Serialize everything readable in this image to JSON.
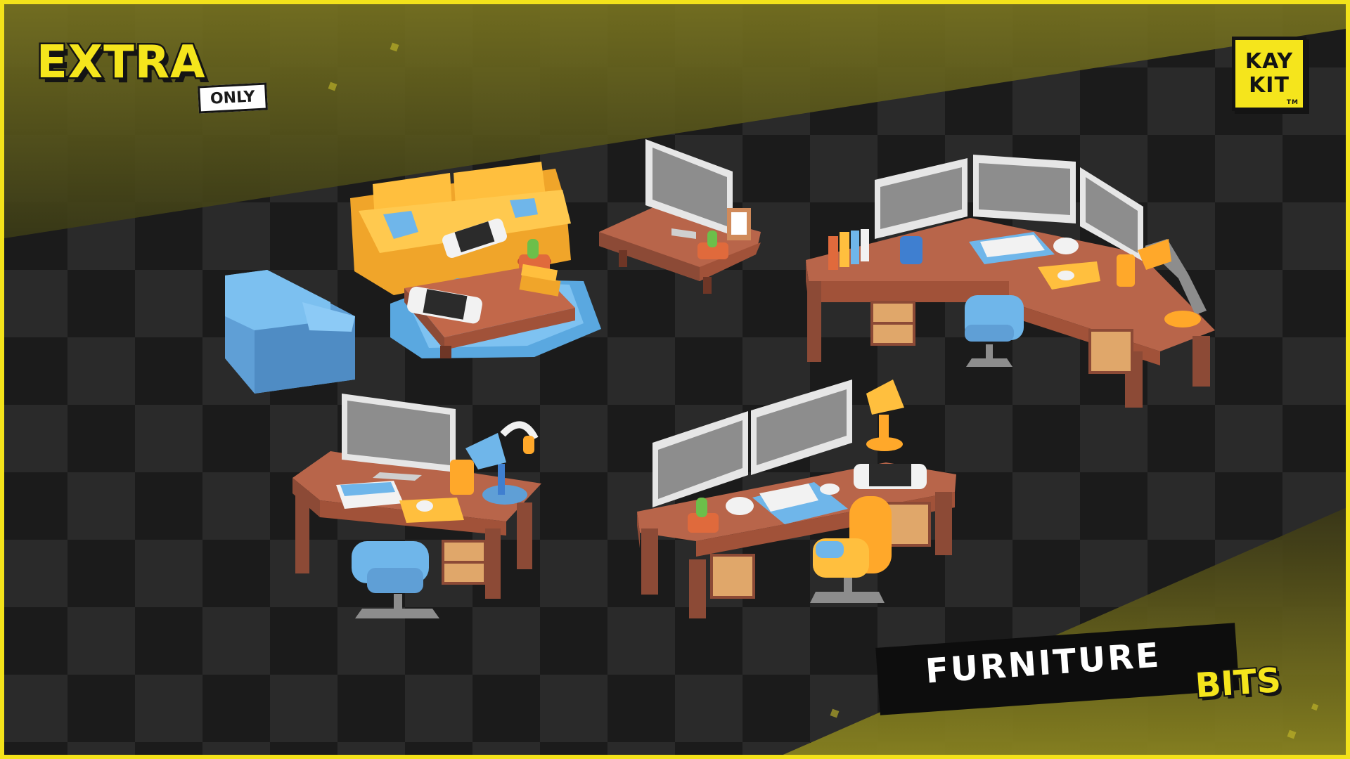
{
  "badge": {
    "extra_label": "EXTRA",
    "only_label": "ONLY"
  },
  "brand": {
    "line1": "KAY",
    "line2": "KIT",
    "tm": "TM"
  },
  "title": {
    "main": "FURNITURE",
    "accent": "BITS"
  },
  "colors": {
    "accent_yellow": "#f5e51c",
    "background_dark": "#1b1b1b",
    "checker_light": "#2b2b2b",
    "wood": "#b8654a",
    "wood_dark": "#8c4a36",
    "blue": "#6fb6ea",
    "orange_yellow": "#ffbe3a",
    "monitor_gray": "#8d8d8d"
  }
}
